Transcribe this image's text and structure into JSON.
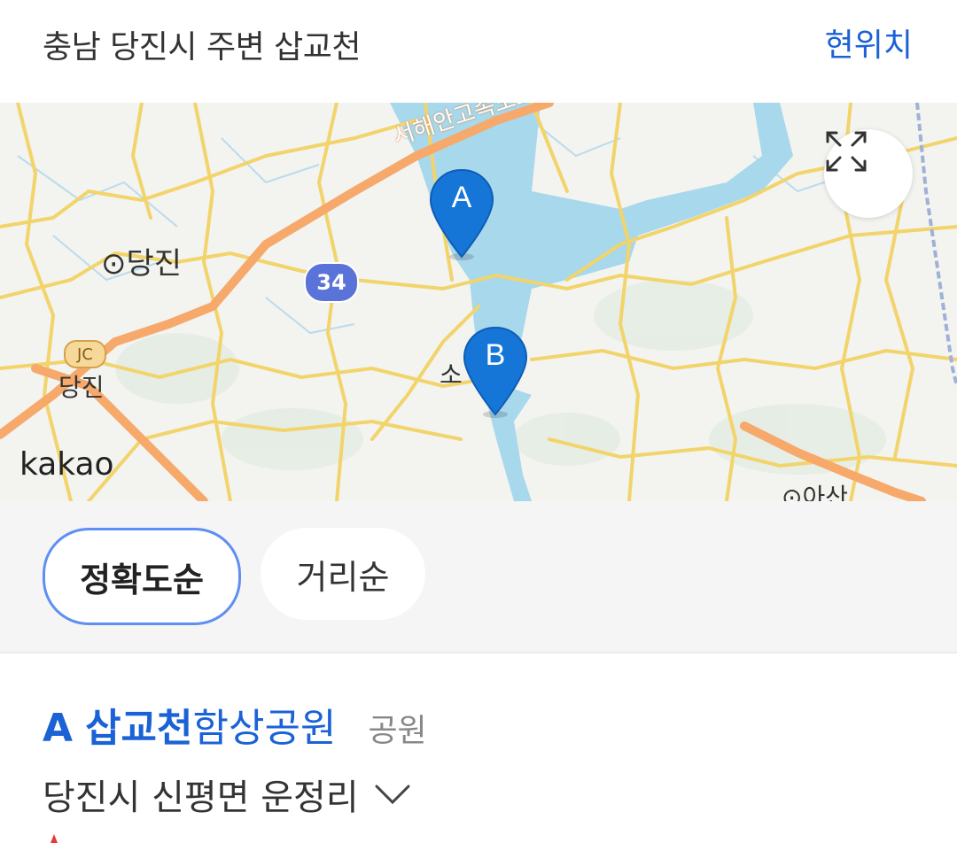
{
  "header": {
    "location_title": "충남 당진시 주변 삽교천",
    "current_location_label": "현위치"
  },
  "map": {
    "labels": {
      "dangjin_city": "⊙당진",
      "dangjin_jc": "당진",
      "jc_badge": "JC",
      "route_number": "34",
      "highway": "서해안고속도로",
      "so": "소",
      "asan": "⊙아산",
      "kakao": "kakao"
    },
    "pins": [
      {
        "letter": "A"
      },
      {
        "letter": "B"
      }
    ],
    "colors": {
      "water": "#a8d8ec",
      "road": "#f2d46b",
      "highway": "#f6a96a",
      "pin": "#1576d8",
      "land": "#f3f3f0"
    }
  },
  "sort": {
    "accuracy_label": "정확도순",
    "distance_label": "거리순",
    "selected": "정확도순"
  },
  "results": [
    {
      "letter": "A",
      "name_highlight": "삽교천",
      "name_rest": "함상공원",
      "category": "공원",
      "address": "당진시 신평면 운정리"
    }
  ]
}
